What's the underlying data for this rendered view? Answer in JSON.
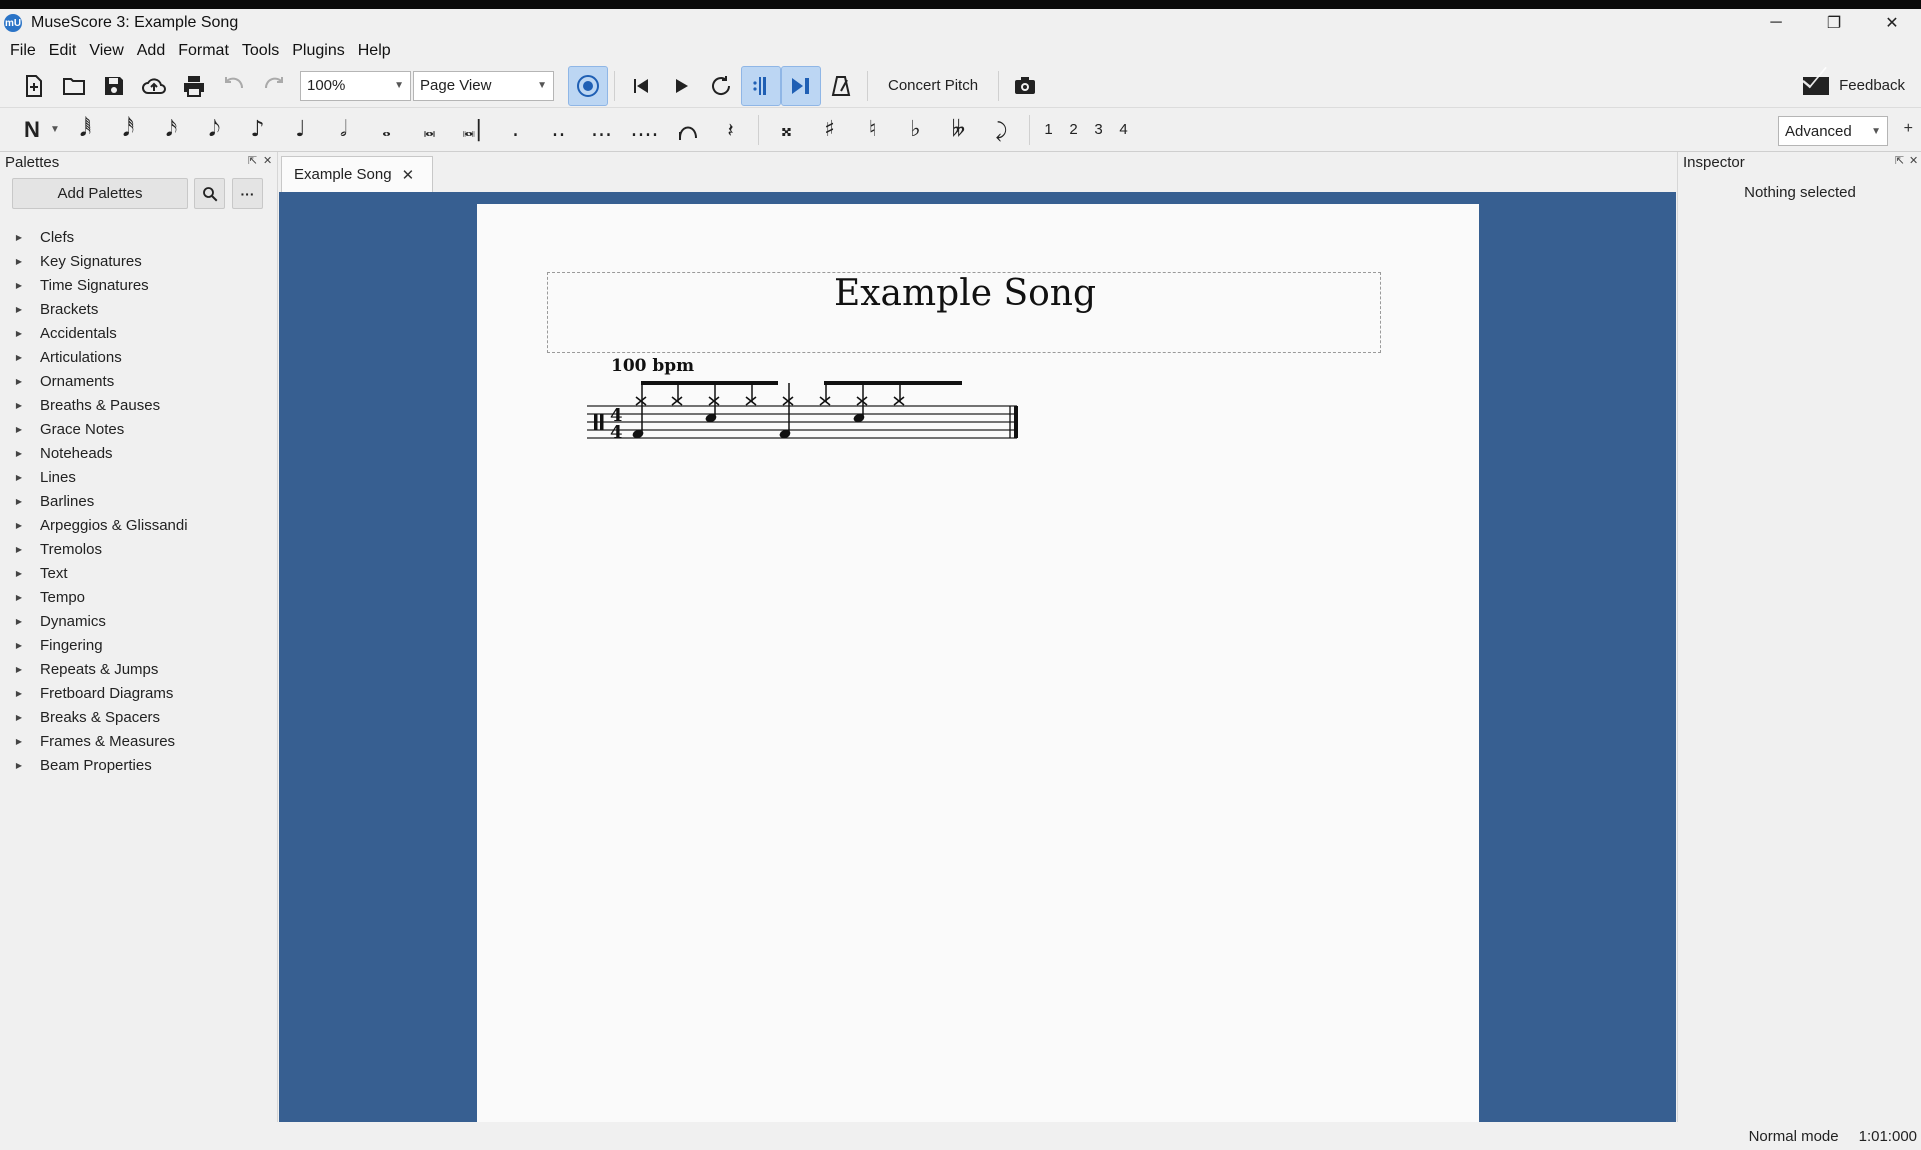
{
  "window": {
    "title": "MuseScore 3: Example Song",
    "icon_label": "mU",
    "controls": {
      "minimize": "─",
      "restore": "❐",
      "close": "✕"
    }
  },
  "menu": [
    "File",
    "Edit",
    "View",
    "Add",
    "Format",
    "Tools",
    "Plugins",
    "Help"
  ],
  "toolbar": {
    "zoom_value": "100%",
    "view_mode": "Page View",
    "concert_pitch": "Concert Pitch",
    "feedback": "Feedback"
  },
  "note_input": {
    "durations": [
      "𝅘𝅥𝅱",
      "𝅘𝅥𝅰",
      "𝅘𝅥𝅯",
      "𝅘𝅥𝅮",
      "♪",
      "♩",
      "𝅗𝅥",
      "𝅝",
      "𝅜",
      "𝅜|",
      ".",
      "..",
      "...",
      "...."
    ],
    "accidentals": [
      "𝄪",
      "♯",
      "♮",
      "♭",
      "𝄫"
    ],
    "voices": [
      "1",
      "2",
      "3",
      "4"
    ],
    "workspace": "Advanced",
    "workspace_add": "+"
  },
  "palettes": {
    "title": "Palettes",
    "add_button": "Add Palettes",
    "search_icon": "search-icon",
    "more_label": "···",
    "items": [
      "Clefs",
      "Key Signatures",
      "Time Signatures",
      "Brackets",
      "Accidentals",
      "Articulations",
      "Ornaments",
      "Breaths & Pauses",
      "Grace Notes",
      "Noteheads",
      "Lines",
      "Barlines",
      "Arpeggios & Glissandi",
      "Tremolos",
      "Text",
      "Tempo",
      "Dynamics",
      "Fingering",
      "Repeats & Jumps",
      "Fretboard Diagrams",
      "Breaks & Spacers",
      "Frames & Measures",
      "Beam Properties"
    ]
  },
  "score": {
    "tab_label": "Example Song",
    "title": "Example Song",
    "tempo": "100 bpm",
    "time_signature": {
      "top": "4",
      "bottom": "4"
    }
  },
  "inspector": {
    "title": "Inspector",
    "empty_text": "Nothing selected"
  },
  "status": {
    "mode": "Normal mode",
    "position": "1:01:000"
  },
  "colors": {
    "canvas_bg": "#375f91",
    "page_bg": "#fafafa",
    "active_button": "#bcd6f3"
  }
}
